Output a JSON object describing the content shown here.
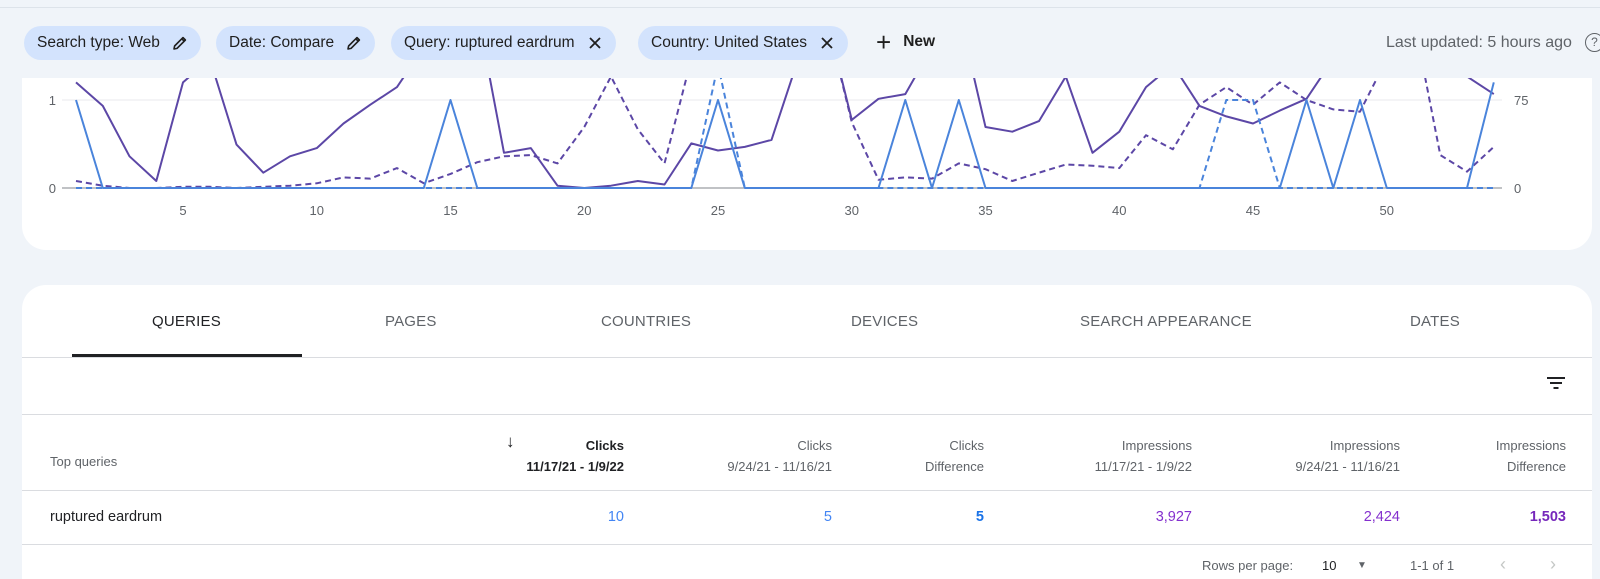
{
  "filters": [
    {
      "label": "Search type: Web",
      "action": "edit"
    },
    {
      "label": "Date: Compare",
      "action": "edit"
    },
    {
      "label": "Query: ruptured eardrum",
      "action": "remove"
    },
    {
      "label": "Country: United States",
      "action": "remove"
    }
  ],
  "new_button": {
    "label": "New",
    "icon": "plus-icon"
  },
  "last_updated": "Last updated: 5 hours ago",
  "help_icon": "help-icon",
  "chart_data": {
    "type": "line",
    "x": [
      1,
      2,
      3,
      4,
      5,
      6,
      7,
      8,
      9,
      10,
      11,
      12,
      13,
      14,
      15,
      16,
      17,
      18,
      19,
      20,
      21,
      22,
      23,
      24,
      25,
      26,
      27,
      28,
      29,
      30,
      31,
      32,
      33,
      34,
      35,
      36,
      37,
      38,
      39,
      40,
      41,
      42,
      43,
      44,
      45,
      46,
      47,
      48,
      49,
      50,
      51,
      52,
      53,
      54
    ],
    "x_ticks": [
      5,
      10,
      15,
      20,
      25,
      30,
      35,
      40,
      45,
      50
    ],
    "y_left_ticks": [
      0,
      1
    ],
    "y_right_ticks": [
      0,
      75
    ],
    "colors": {
      "clicks": "#4a84db",
      "impressions": "#5c47a6",
      "gridline": "#e8eaed"
    },
    "series": [
      {
        "axis": "left",
        "style": "solid",
        "color": "#4a84db",
        "values": [
          1,
          0,
          0,
          0,
          0,
          0,
          0,
          0,
          0,
          0,
          0,
          0,
          0,
          0,
          1,
          0,
          0,
          0,
          0,
          0,
          0,
          0,
          0,
          0,
          1,
          0,
          0,
          0,
          0,
          0,
          0,
          1,
          0,
          1,
          0,
          0,
          0,
          0,
          0,
          0,
          0,
          0,
          0,
          0,
          0,
          0,
          1,
          0,
          1,
          0,
          0,
          0,
          0,
          1.2
        ]
      },
      {
        "axis": "left",
        "style": "dashed",
        "color": "#4a84db",
        "values": [
          0,
          0,
          0,
          0,
          0,
          0,
          0,
          0,
          0,
          0,
          0,
          0,
          0,
          0,
          0,
          0,
          0,
          0,
          0,
          0,
          0,
          0,
          0,
          0,
          1.4,
          0,
          0,
          0,
          0,
          0,
          0,
          0,
          0,
          0,
          0,
          0,
          0,
          0,
          0,
          0,
          0,
          0,
          0,
          1,
          1,
          0,
          0,
          0,
          0,
          0,
          0,
          0,
          0,
          0
        ]
      },
      {
        "axis": "right",
        "style": "solid",
        "color": "#5c47a6",
        "values": [
          90,
          70,
          27,
          6,
          90,
          110,
          37,
          13,
          27,
          34,
          55,
          71,
          86,
          120,
          130,
          150,
          30,
          34,
          2,
          0,
          2,
          6,
          3,
          38,
          32,
          35,
          41,
          110,
          150,
          58,
          76,
          80,
          120,
          150,
          52,
          48,
          57,
          95,
          30,
          48,
          86,
          105,
          70,
          61,
          55,
          66,
          76,
          110,
          140,
          150,
          160,
          170,
          95,
          80
        ]
      },
      {
        "axis": "right",
        "style": "dashed",
        "color": "#5c47a6",
        "values": [
          6,
          2,
          0,
          0,
          1,
          1,
          0,
          1,
          2,
          4,
          9,
          8,
          17,
          4,
          12,
          22,
          27,
          28,
          21,
          52,
          95,
          50,
          21,
          110,
          150,
          150,
          105,
          150,
          150,
          56,
          7,
          9,
          8,
          21,
          16,
          6,
          13,
          20,
          19,
          17,
          45,
          33,
          71,
          86,
          71,
          90,
          75,
          67,
          65,
          110,
          145,
          28,
          14,
          35
        ]
      }
    ]
  },
  "tabs": [
    "QUERIES",
    "PAGES",
    "COUNTRIES",
    "DEVICES",
    "SEARCH APPEARANCE",
    "DATES"
  ],
  "filter_rows_icon": "filter-list-icon",
  "table": {
    "columns": [
      {
        "line1": "Top queries",
        "line2": ""
      },
      {
        "line1": "Clicks",
        "line2": "11/17/21 - 1/9/22"
      },
      {
        "line1": "Clicks",
        "line2": "9/24/21 - 11/16/21"
      },
      {
        "line1": "Clicks",
        "line2": "Difference"
      },
      {
        "line1": "Impressions",
        "line2": "11/17/21 - 1/9/22"
      },
      {
        "line1": "Impressions",
        "line2": "9/24/21 - 11/16/21"
      },
      {
        "line1": "Impressions",
        "line2": "Difference"
      }
    ],
    "sort_icon": "arrow-down-icon",
    "rows": [
      {
        "query": "ruptured eardrum",
        "clicks_current": "10",
        "clicks_previous": "5",
        "clicks_diff": "5",
        "impressions_current": "3,927",
        "impressions_previous": "2,424",
        "impressions_diff": "1,503"
      }
    ]
  },
  "pagination": {
    "rows_per_page_label": "Rows per page:",
    "rows_per_page_value": "10",
    "range": "1-1 of 1"
  }
}
